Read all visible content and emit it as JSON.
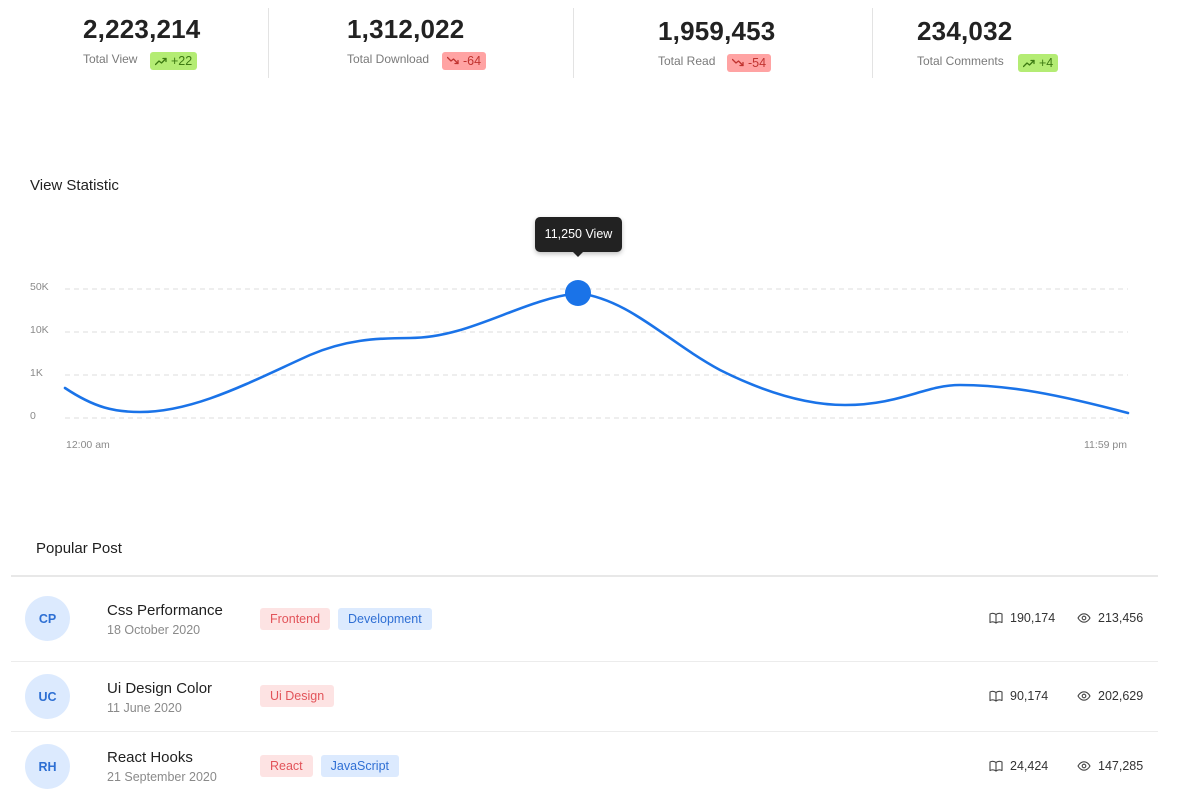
{
  "stats": [
    {
      "value": "2,223,214",
      "label": "Total View",
      "change": "+22",
      "trend": "up"
    },
    {
      "value": "1,312,022",
      "label": "Total Download",
      "change": "-64",
      "trend": "down"
    },
    {
      "value": "1,959,453",
      "label": "Total Read",
      "change": "-54",
      "trend": "down"
    },
    {
      "value": "234,032",
      "label": "Total Comments",
      "change": "+4",
      "trend": "up"
    }
  ],
  "view_statistic": {
    "title": "View Statistic",
    "tooltip": "11,250 View",
    "y_ticks": [
      "50K",
      "10K",
      "1K",
      "0"
    ],
    "x_start": "12:00 am",
    "x_end": "11:59 pm",
    "line_color": "#1a73e8"
  },
  "popular_post": {
    "title": "Popular Post",
    "posts": [
      {
        "initials": "CP",
        "title": "Css Performance",
        "date": "18 October 2020",
        "tags": [
          {
            "label": "Frontend",
            "color": "red"
          },
          {
            "label": "Development",
            "color": "blue"
          }
        ],
        "reads": "190,174",
        "views": "213,456"
      },
      {
        "initials": "UC",
        "title": "Ui Design Color",
        "date": "11 June 2020",
        "tags": [
          {
            "label": "Ui Design",
            "color": "red"
          }
        ],
        "reads": "90,174",
        "views": "202,629"
      },
      {
        "initials": "RH",
        "title": "React Hooks",
        "date": "21 September 2020",
        "tags": [
          {
            "label": "React",
            "color": "red"
          },
          {
            "label": "JavaScript",
            "color": "blue"
          }
        ],
        "reads": "24,424",
        "views": "147,285"
      }
    ]
  },
  "icons": {
    "trend_up": "trend-up-icon",
    "trend_down": "trend-down-icon",
    "reads": "book-icon",
    "views": "eye-icon"
  }
}
